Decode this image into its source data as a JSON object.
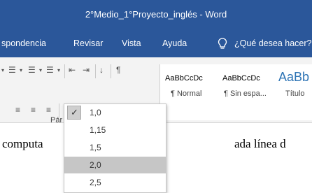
{
  "window": {
    "title": "2°Medio_1°Proyecto_inglés  -  Word"
  },
  "tabs": [
    {
      "label": "spondencia"
    },
    {
      "label": "Revisar"
    },
    {
      "label": "Vista"
    },
    {
      "label": "Ayuda"
    },
    {
      "label": "¿Qué desea hacer?"
    }
  ],
  "ribbon": {
    "group_label": "Pár",
    "styles": [
      {
        "sample": "AaBbCcDc",
        "name": "¶ Normal"
      },
      {
        "sample": "AaBbCcDc",
        "name": "¶ Sin espa..."
      },
      {
        "sample": "AaBb",
        "name": "Título"
      }
    ]
  },
  "document": {
    "left_text": "computa",
    "right_text": "ada línea d"
  },
  "line_spacing_menu": {
    "checked": "1,0",
    "highlighted": "2,0",
    "options": [
      "1,0",
      "1,15",
      "1,5",
      "2,0",
      "2,5"
    ]
  },
  "colors": {
    "titlebar": "#2b579a",
    "ribbon": "#f3f3f3",
    "highlight": "#c6c6c6"
  },
  "icons": [
    "lightbulb-icon",
    "bullets-icon",
    "numbering-icon",
    "multilevel-list-icon",
    "decrease-indent-icon",
    "increase-indent-icon",
    "sort-icon",
    "pilcrow-icon",
    "align-center-icon",
    "align-right-icon",
    "justify-icon",
    "line-spacing-icon",
    "shading-icon",
    "borders-icon",
    "check-icon"
  ]
}
